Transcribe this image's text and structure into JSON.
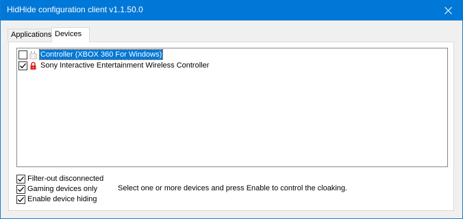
{
  "window": {
    "title": "HidHide configuration client v1.1.50.0",
    "accent_color": "#0078d7",
    "close_icon": "close-icon"
  },
  "tabs": [
    {
      "label": "Applications",
      "selected": false
    },
    {
      "label": "Devices",
      "selected": true
    }
  ],
  "devices": [
    {
      "label": "Controller (XBOX 360 For Windows)",
      "checked": false,
      "selected": true,
      "icon": "gamepad-icon"
    },
    {
      "label": "Sony Interactive Entertainment Wireless Controller",
      "checked": true,
      "selected": false,
      "icon": "lock-icon"
    }
  ],
  "options": [
    {
      "label": "Filter-out disconnected",
      "checked": true
    },
    {
      "label": "Gaming devices only",
      "checked": true
    },
    {
      "label": "Enable device hiding",
      "checked": true
    }
  ],
  "hint": "Select one or more devices and press Enable to control the cloaking."
}
